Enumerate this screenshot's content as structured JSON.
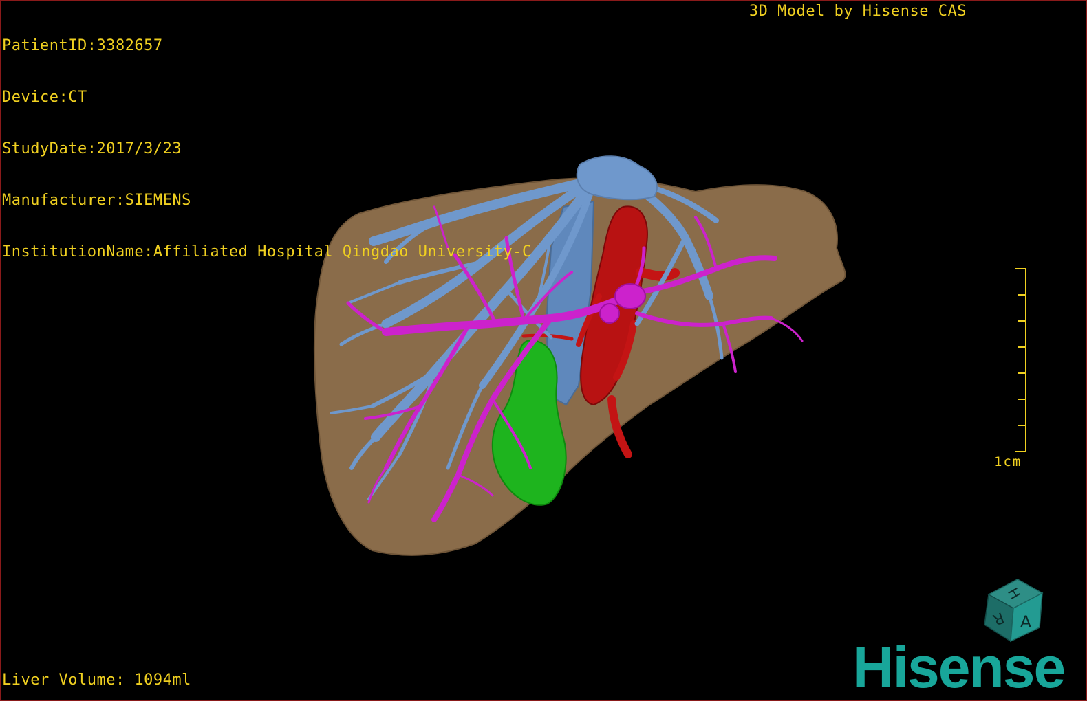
{
  "patient_info": {
    "patient_id": "PatientID:3382657",
    "device": "Device:CT",
    "study_date": "StudyDate:2017/3/23",
    "manufacturer": "Manufacturer:SIEMENS",
    "institution": "InstitutionName:Affiliated Hospital Qingdao University-C"
  },
  "model_credit": "3D Model by Hisense CAS",
  "liver_volume": "Liver Volume: 1094ml",
  "scale_bar": {
    "label": "1cm"
  },
  "orientation_cube": {
    "labels": [
      "H",
      "R",
      "A"
    ]
  },
  "logo": "Hisense",
  "colors": {
    "overlay_text": "#f0d020",
    "liver": "#8a6c4a",
    "hepatic_vein": "#6f98cc",
    "portal_vein": "#cc22cc",
    "artery_ivc": "#c41414",
    "gallbladder": "#1eb41e",
    "brand": "#18a69a"
  }
}
